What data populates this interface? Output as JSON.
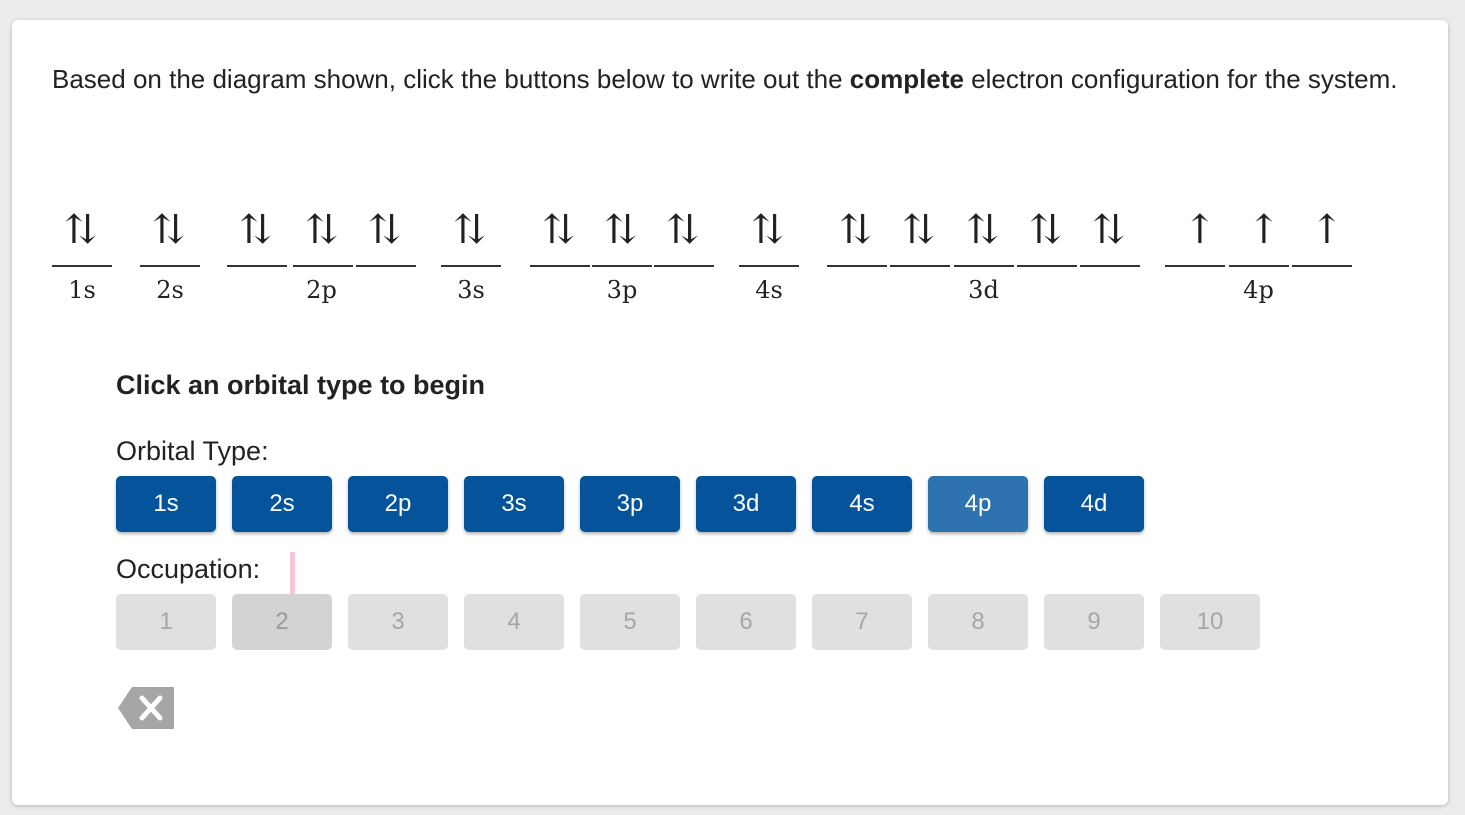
{
  "prompt": {
    "before": "Based on the diagram shown, click the buttons below to write out the ",
    "bold": "complete",
    "after": " electron configuration for the system."
  },
  "diagram": {
    "sublevels": [
      {
        "label": "1s",
        "orbitals": [
          "paired"
        ]
      },
      {
        "label": "2s",
        "orbitals": [
          "paired"
        ]
      },
      {
        "label": "2p",
        "orbitals": [
          "paired",
          "paired",
          "paired"
        ]
      },
      {
        "label": "3s",
        "orbitals": [
          "paired"
        ]
      },
      {
        "label": "3p",
        "orbitals": [
          "paired",
          "paired",
          "paired"
        ]
      },
      {
        "label": "4s",
        "orbitals": [
          "paired"
        ]
      },
      {
        "label": "3d",
        "orbitals": [
          "paired",
          "paired",
          "paired",
          "paired",
          "paired"
        ]
      },
      {
        "label": "4p",
        "orbitals": [
          "up",
          "up",
          "up"
        ]
      }
    ],
    "paired_glyph": "⇅",
    "up_glyph": "↑"
  },
  "instruction": "Click an orbital type to begin",
  "orbital_type": {
    "label": "Orbital Type:",
    "buttons": [
      "1s",
      "2s",
      "2p",
      "3s",
      "3p",
      "3d",
      "4s",
      "4p",
      "4d"
    ],
    "active": "4p",
    "color": "#04539b"
  },
  "occupation": {
    "label": "Occupation:",
    "buttons": [
      "1",
      "2",
      "3",
      "4",
      "5",
      "6",
      "7",
      "8",
      "9",
      "10"
    ]
  },
  "backspace_icon": "backspace-icon"
}
